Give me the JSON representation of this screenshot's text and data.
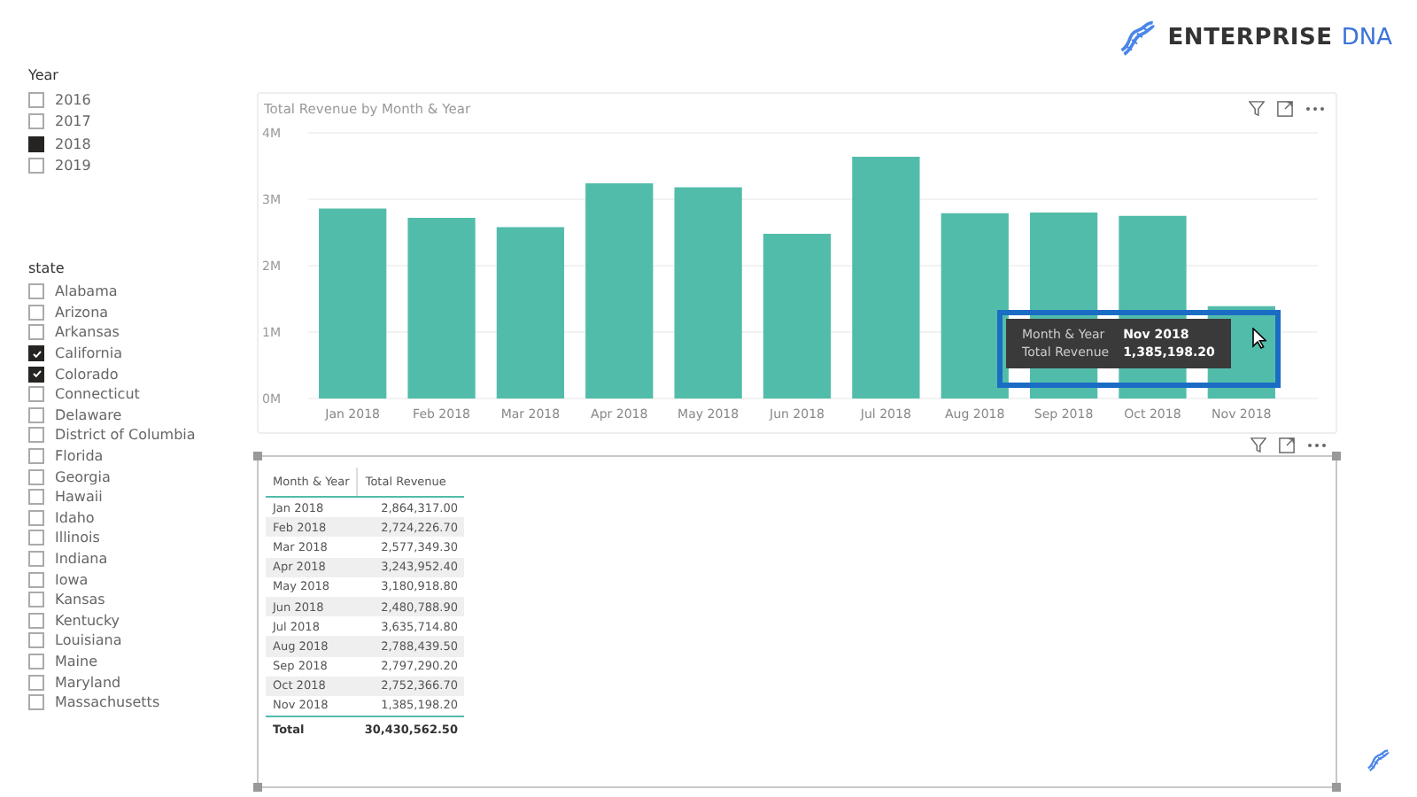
{
  "logo": {
    "brand": "ENTERPRISE",
    "accent": "DNA"
  },
  "year_slicer": {
    "title": "Year",
    "items": [
      {
        "label": "2016",
        "checked": false
      },
      {
        "label": "2017",
        "checked": false
      },
      {
        "label": "2018",
        "checked": true
      },
      {
        "label": "2019",
        "checked": false
      }
    ]
  },
  "state_slicer": {
    "title": "state",
    "items": [
      {
        "label": "Alabama",
        "checked": false
      },
      {
        "label": "Arizona",
        "checked": false
      },
      {
        "label": "Arkansas",
        "checked": false
      },
      {
        "label": "California",
        "checked": true
      },
      {
        "label": "Colorado",
        "checked": true
      },
      {
        "label": "Connecticut",
        "checked": false
      },
      {
        "label": "Delaware",
        "checked": false
      },
      {
        "label": "District of Columbia",
        "checked": false
      },
      {
        "label": "Florida",
        "checked": false
      },
      {
        "label": "Georgia",
        "checked": false
      },
      {
        "label": "Hawaii",
        "checked": false
      },
      {
        "label": "Idaho",
        "checked": false
      },
      {
        "label": "Illinois",
        "checked": false
      },
      {
        "label": "Indiana",
        "checked": false
      },
      {
        "label": "Iowa",
        "checked": false
      },
      {
        "label": "Kansas",
        "checked": false
      },
      {
        "label": "Kentucky",
        "checked": false
      },
      {
        "label": "Louisiana",
        "checked": false
      },
      {
        "label": "Maine",
        "checked": false
      },
      {
        "label": "Maryland",
        "checked": false
      },
      {
        "label": "Massachusetts",
        "checked": false
      }
    ]
  },
  "chart": {
    "chart_data": {
      "type": "bar",
      "title": "Total Revenue by Month & Year",
      "categories": [
        "Jan 2018",
        "Feb 2018",
        "Mar 2018",
        "Apr 2018",
        "May 2018",
        "Jun 2018",
        "Jul 2018",
        "Aug 2018",
        "Sep 2018",
        "Oct 2018",
        "Nov 2018"
      ],
      "series": [
        {
          "color": "#52bcaa",
          "values": [
            2860000,
            2720000,
            2580000,
            3240000,
            3180000,
            2480000,
            3640000,
            2790000,
            2800000,
            2750000,
            1390000
          ]
        }
      ],
      "grid": true,
      "ylim": [
        0,
        4000000
      ],
      "yticks": [
        {
          "value": 0,
          "label": "0M"
        },
        {
          "value": 1000000,
          "label": "1M"
        },
        {
          "value": 2000000,
          "label": "2M"
        },
        {
          "value": 3000000,
          "label": "3M"
        },
        {
          "value": 4000000,
          "label": "4M"
        }
      ]
    },
    "tooltip": {
      "fields": [
        {
          "label": "Month & Year",
          "value": "Nov 2018"
        },
        {
          "label": "Total Revenue",
          "value": "1,385,198.20"
        }
      ]
    }
  },
  "table": {
    "columns": [
      "Month & Year",
      "Total Revenue"
    ],
    "rows": [
      [
        "Jan 2018",
        "2,864,317.00"
      ],
      [
        "Feb 2018",
        "2,724,226.70"
      ],
      [
        "Mar 2018",
        "2,577,349.30"
      ],
      [
        "Apr 2018",
        "3,243,952.40"
      ],
      [
        "May 2018",
        "3,180,918.80"
      ],
      [
        "Jun 2018",
        "2,480,788.90"
      ],
      [
        "Jul 2018",
        "3,635,714.80"
      ],
      [
        "Aug 2018",
        "2,788,439.50"
      ],
      [
        "Sep 2018",
        "2,797,290.20"
      ],
      [
        "Oct 2018",
        "2,752,366.70"
      ],
      [
        "Nov 2018",
        "1,385,198.20"
      ]
    ],
    "total": [
      "Total",
      "30,430,562.50"
    ]
  }
}
